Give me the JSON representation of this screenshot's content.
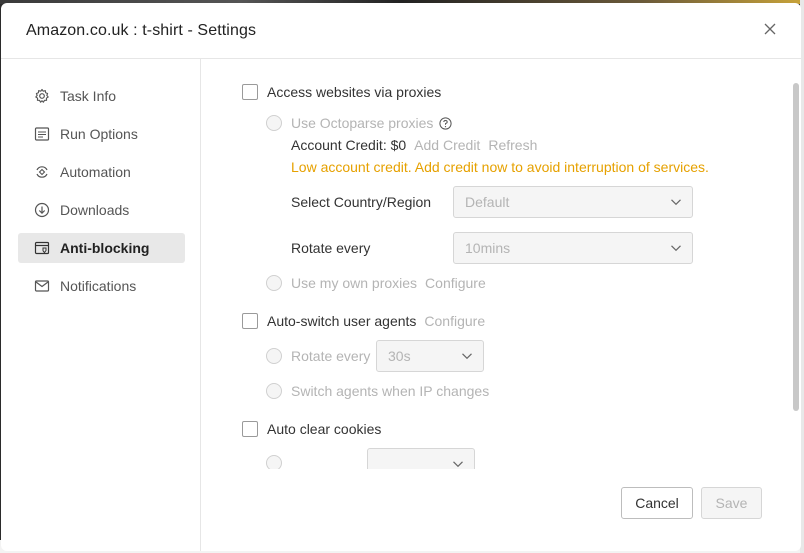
{
  "dialog": {
    "title": "Amazon.co.uk : t-shirt - Settings"
  },
  "sidebar": {
    "items": [
      {
        "label": "Task Info",
        "icon": "gear-icon"
      },
      {
        "label": "Run Options",
        "icon": "list-icon"
      },
      {
        "label": "Automation",
        "icon": "automation-icon"
      },
      {
        "label": "Downloads",
        "icon": "download-icon"
      },
      {
        "label": "Anti-blocking",
        "icon": "browser-shield-icon",
        "active": true
      },
      {
        "label": "Notifications",
        "icon": "mail-icon"
      }
    ]
  },
  "proxies": {
    "label": "Access websites via proxies",
    "octoparse_label": "Use Octoparse proxies",
    "account_credit_label": "Account Credit: $0",
    "add_credit": "Add Credit",
    "refresh": "Refresh",
    "warning": "Low account credit. Add credit now to avoid interruption of services.",
    "country_label": "Select Country/Region",
    "country_value": "Default",
    "rotate_label": "Rotate every",
    "rotate_value": "10mins",
    "own_proxies_label": "Use my own proxies",
    "configure": "Configure"
  },
  "user_agents": {
    "label": "Auto-switch user agents",
    "configure": "Configure",
    "rotate_label": "Rotate every",
    "rotate_value": "30s",
    "switch_ip_label": "Switch agents when IP changes"
  },
  "cookies": {
    "label": "Auto clear cookies"
  },
  "footer": {
    "cancel": "Cancel",
    "save": "Save"
  },
  "colors": {
    "warning": "#e6a100",
    "active_nav_bg": "#e8e8e8"
  }
}
